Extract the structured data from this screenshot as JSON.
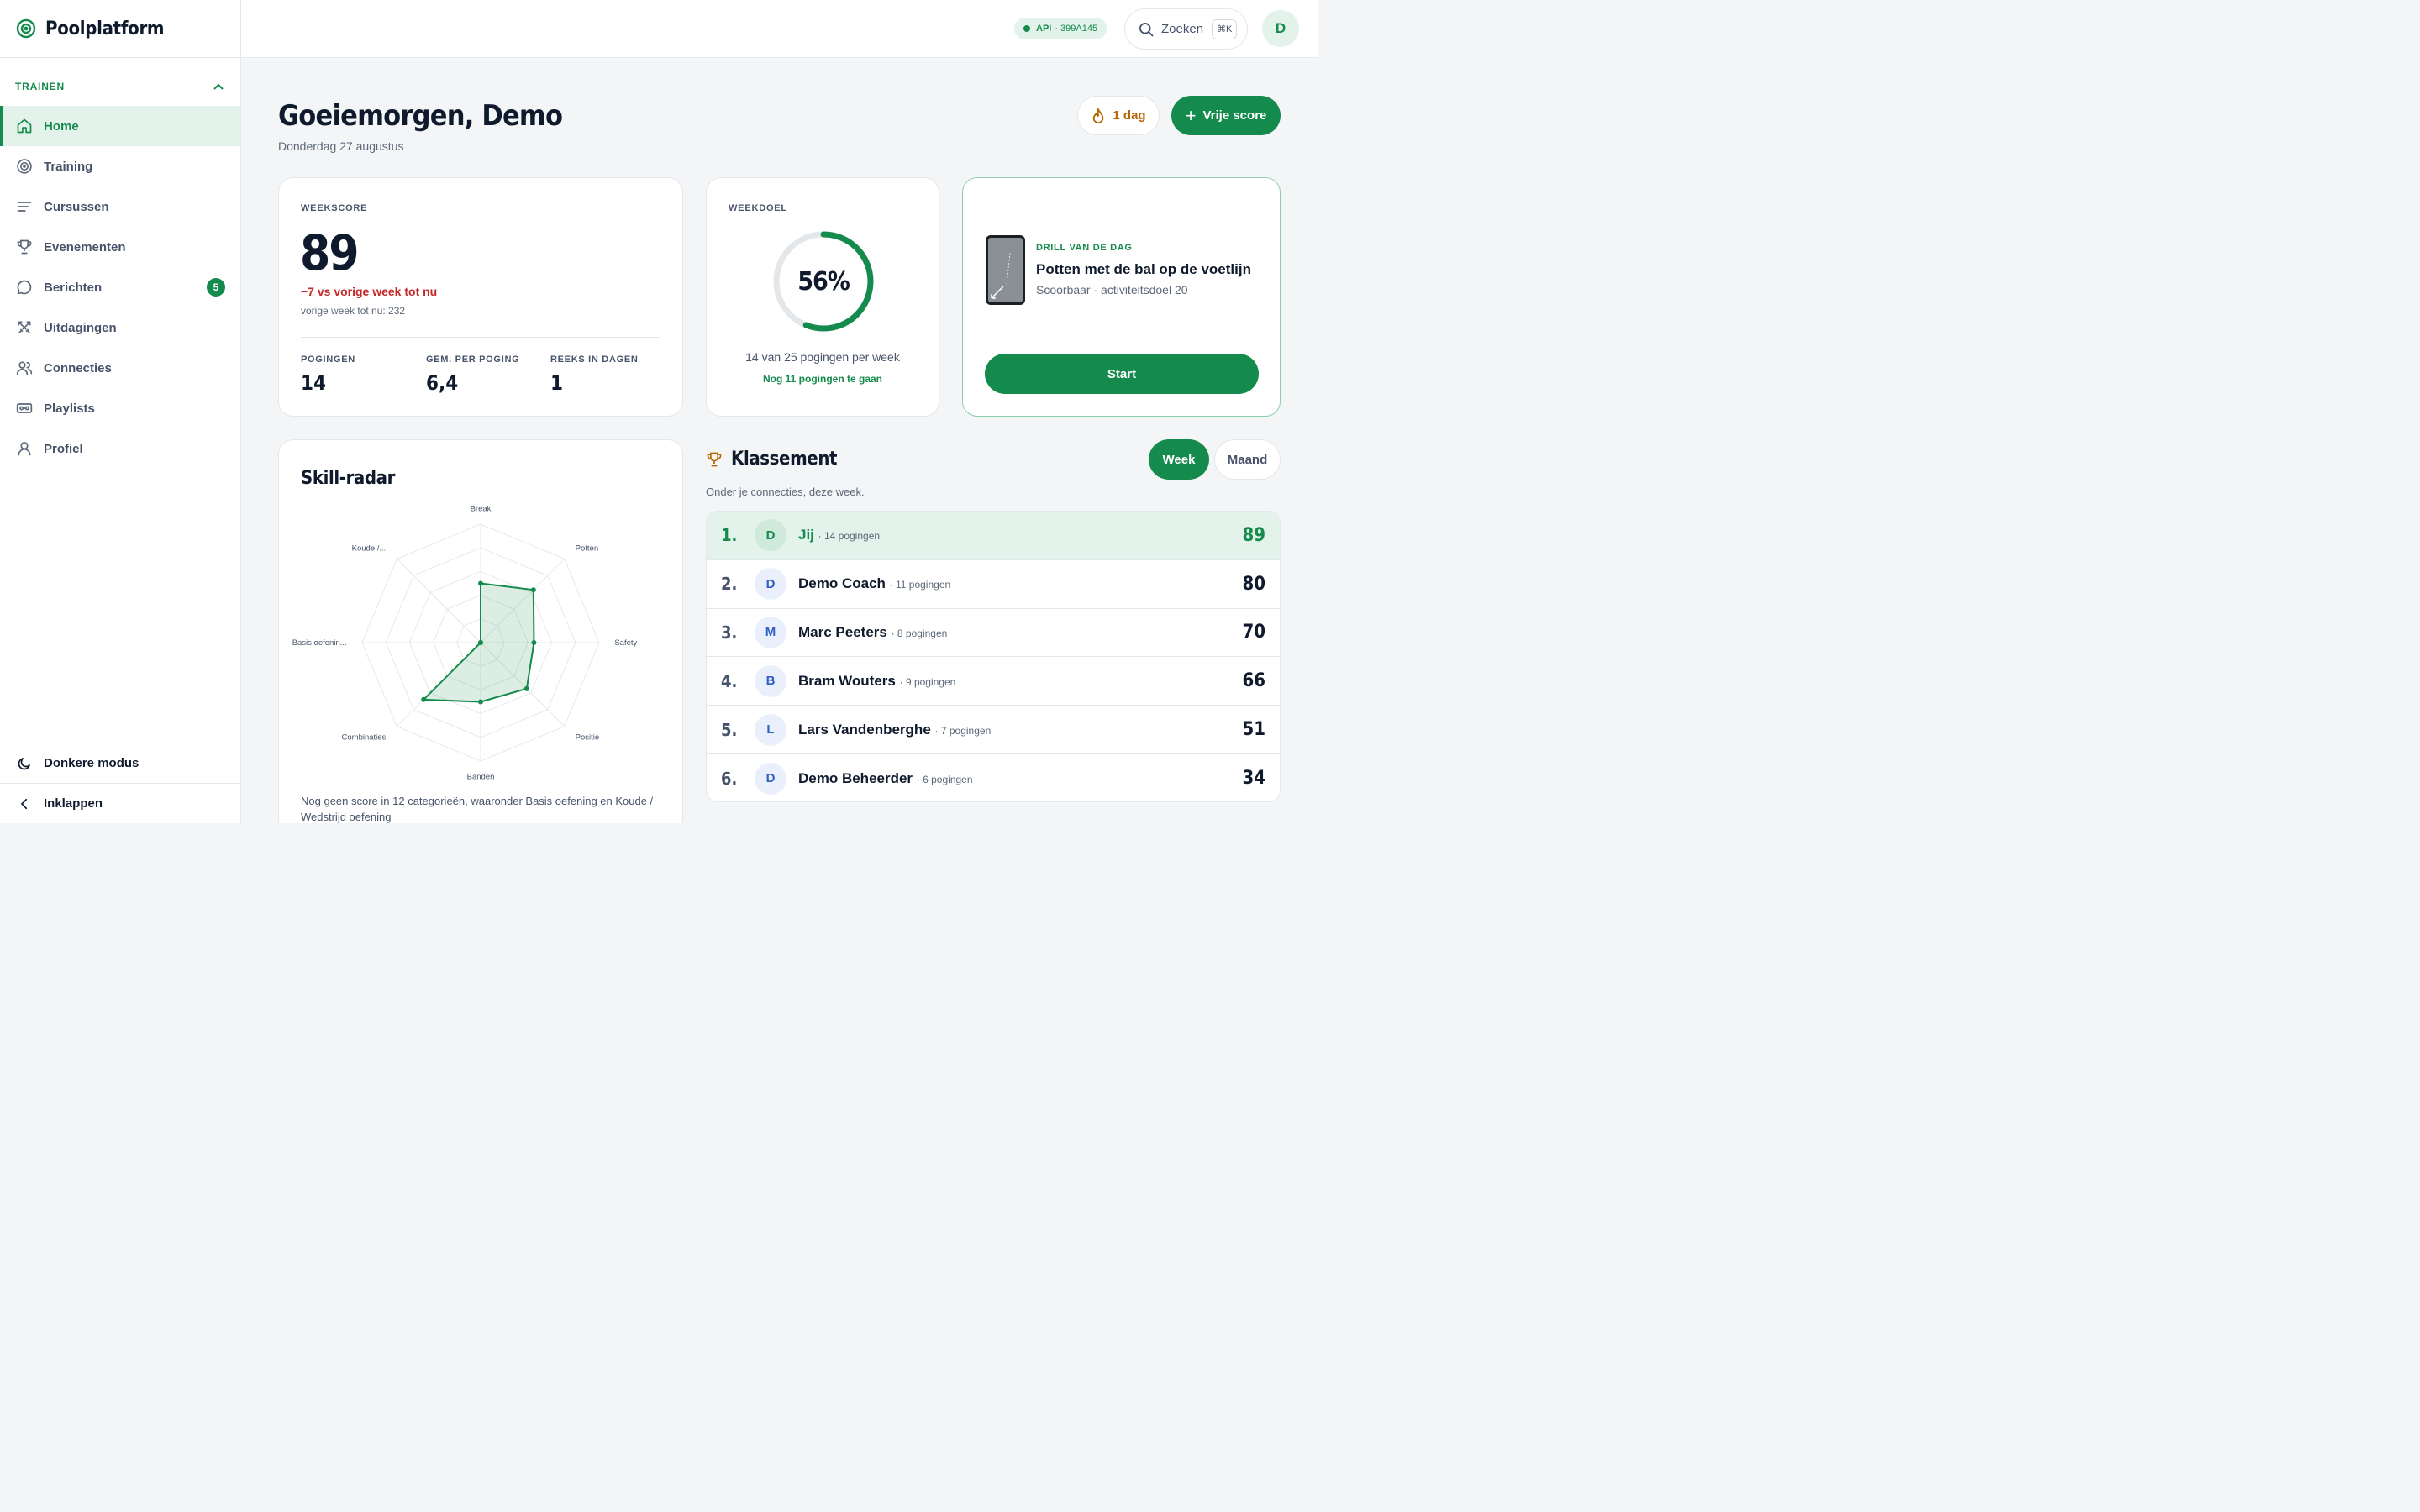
{
  "app": {
    "name": "Poolplatform"
  },
  "sidebar": {
    "section_title": "TRAINEN",
    "items": [
      {
        "label": "Home",
        "icon": "home-icon",
        "active": true
      },
      {
        "label": "Training",
        "icon": "target-icon"
      },
      {
        "label": "Cursussen",
        "icon": "list-icon"
      },
      {
        "label": "Evenementen",
        "icon": "trophy-icon"
      },
      {
        "label": "Berichten",
        "icon": "chat-icon",
        "badge": "5"
      },
      {
        "label": "Uitdagingen",
        "icon": "swords-icon"
      },
      {
        "label": "Connecties",
        "icon": "users-icon"
      },
      {
        "label": "Playlists",
        "icon": "playlist-icon"
      },
      {
        "label": "Profiel",
        "icon": "user-icon"
      }
    ],
    "dark_mode_label": "Donkere modus",
    "collapse_label": "Inklappen"
  },
  "topbar": {
    "api_label": "API",
    "api_version": "· 399A145",
    "search_label": "Zoeken",
    "search_shortcut": "⌘K",
    "avatar_initial": "D"
  },
  "header": {
    "greeting": "Goeiemorgen, Demo",
    "date": "Donderdag 27 augustus",
    "streak_label": "1 dag",
    "new_score_label": "Vrije score"
  },
  "weekscore": {
    "label": "WEEKSCORE",
    "value": "89",
    "delta": "−7 vs vorige week tot nu",
    "previous": "vorige week tot nu: 232",
    "stats": [
      {
        "label": "POGINGEN",
        "value": "14"
      },
      {
        "label": "GEM. PER POGING",
        "value": "6,4"
      },
      {
        "label": "REEKS IN DAGEN",
        "value": "1"
      }
    ]
  },
  "weekdoel": {
    "label": "WEEKDOEL",
    "percent_text": "56%",
    "progress": 0.56,
    "subtitle": "14 van 25 pogingen per week",
    "remaining": "Nog 11 pogingen te gaan"
  },
  "drill": {
    "tag": "DRILL VAN DE DAG",
    "title": "Potten met de bal op de voetlijn",
    "meta": "Scoorbaar · activiteitsdoel 20",
    "start_label": "Start"
  },
  "radar": {
    "title": "Skill-radar",
    "note": "Nog geen score in 12 categorieën, waaronder Basis oefening en Koude / Wedstrijd oefening",
    "chart_data": {
      "type": "radar",
      "axes": [
        "Break",
        "Potten",
        "Safety",
        "Positie",
        "Banden",
        "Combinaties",
        "Basis oefenin...",
        "Koude /..."
      ],
      "values": [
        0.5,
        0.63,
        0.45,
        0.55,
        0.5,
        0.68,
        0,
        0
      ],
      "range": [
        0,
        1
      ],
      "rings": 5,
      "color": "#148a4c"
    }
  },
  "klassement": {
    "title": "Klassement",
    "subtitle": "Onder je connecties, deze week.",
    "tab_week": "Week",
    "tab_month": "Maand",
    "rows": [
      {
        "rank": "1.",
        "initial": "D",
        "name": "Jij",
        "attempts": "· 14 pogingen",
        "score": "89",
        "me": true
      },
      {
        "rank": "2.",
        "initial": "D",
        "name": "Demo Coach",
        "attempts": "· 11 pogingen",
        "score": "80"
      },
      {
        "rank": "3.",
        "initial": "M",
        "name": "Marc Peeters",
        "attempts": "· 8 pogingen",
        "score": "70"
      },
      {
        "rank": "4.",
        "initial": "B",
        "name": "Bram Wouters",
        "attempts": "· 9 pogingen",
        "score": "66"
      },
      {
        "rank": "5.",
        "initial": "L",
        "name": "Lars Vandenberghe",
        "attempts": "· 7 pogingen",
        "score": "51"
      },
      {
        "rank": "6.",
        "initial": "D",
        "name": "Demo Beheerder",
        "attempts": "· 6 pogingen",
        "score": "34"
      }
    ]
  },
  "colors": {
    "accent": "#148a4c",
    "accent_soft": "#e3f2ea",
    "danger": "#c62828",
    "warm": "#b86500"
  }
}
